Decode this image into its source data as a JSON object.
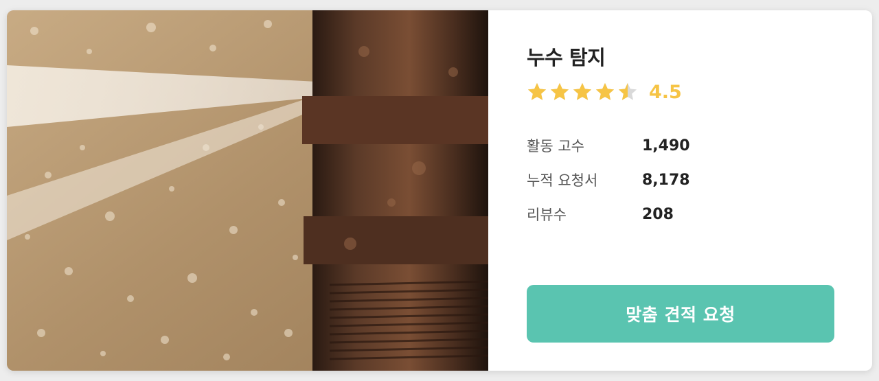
{
  "service": {
    "title": "누수 탐지",
    "rating": 4.5,
    "rating_text": "4.5",
    "max_stars": 5,
    "star_color": "#f6c445",
    "star_empty_color": "#d9d9d9",
    "image_icon": "leaking-pipe-photo"
  },
  "stats": [
    {
      "label": "활동 고수",
      "value": "1,490"
    },
    {
      "label": "누적 요청서",
      "value": "8,178"
    },
    {
      "label": "리뷰수",
      "value": "208"
    }
  ],
  "cta": {
    "label": "맞춤 견적 요청",
    "color": "#5ac4b0"
  }
}
